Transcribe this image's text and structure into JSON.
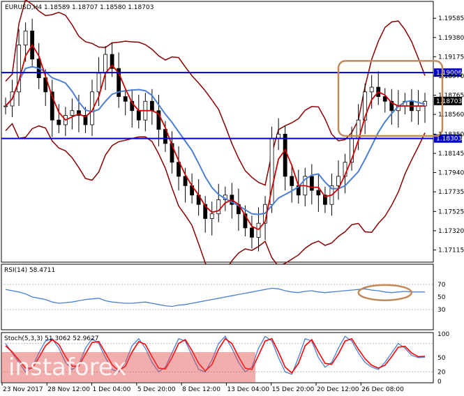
{
  "chart_data": [
    {
      "type": "candlestick",
      "panel": "price",
      "header": "EURUSD,H4  1.18589 1.18707 1.18580 1.18703",
      "ylim": [
        1.17,
        1.1975
      ],
      "y_ticks": [
        "1.19585",
        "1.19380",
        "1.19175",
        "1.18970",
        "1.18765",
        "1.18560",
        "1.18350",
        "1.18145",
        "1.17940",
        "1.17735",
        "1.17525",
        "1.17320",
        "1.17115"
      ],
      "y_tick_values": [
        1.19585,
        1.1938,
        1.19175,
        1.1897,
        1.18765,
        1.1856,
        1.1835,
        1.18145,
        1.1794,
        1.17735,
        1.17525,
        1.1732,
        1.17115
      ],
      "x_ticks": [
        "23 Nov 2017",
        "28 Nov 12:00",
        "1 Dec 04:00",
        "5 Dec 20:00",
        "8 Dec 12:00",
        "13 Dec 04:00",
        "15 Dec 20:00",
        "20 Dec 12:00",
        "26 Dec 08:00"
      ],
      "horizontal_levels": [
        {
          "value": 1.19006,
          "label": "1.19006",
          "color": "#0000cc"
        },
        {
          "value": 1.18303,
          "label": "1.18303",
          "color": "#0000cc"
        }
      ],
      "current_price": {
        "value": 1.18703,
        "label": "1.18703"
      },
      "series": [
        {
          "name": "",
          "color": "#cc0000",
          "kind": "ma_fast"
        },
        {
          "name": "",
          "color": "#4a7fd4",
          "kind": "ma_slow"
        },
        {
          "name": "",
          "color": "#8b0000",
          "kind": "bollinger"
        }
      ],
      "close_path": [
        1.1865,
        1.188,
        1.193,
        1.1945,
        1.1915,
        1.1895,
        1.188,
        1.185,
        1.1845,
        1.1855,
        1.186,
        1.1855,
        1.1845,
        1.188,
        1.19,
        1.192,
        1.1905,
        1.1875,
        1.187,
        1.186,
        1.185,
        1.187,
        1.186,
        1.184,
        1.1825,
        1.1805,
        1.179,
        1.178,
        1.177,
        1.176,
        1.1745,
        1.175,
        1.1765,
        1.177,
        1.176,
        1.175,
        1.1735,
        1.1725,
        1.174,
        1.176,
        1.183,
        1.1835,
        1.179,
        1.178,
        1.177,
        1.179,
        1.1775,
        1.177,
        1.176,
        1.178,
        1.179,
        1.1805,
        1.183,
        1.185,
        1.188,
        1.1885,
        1.1875,
        1.187,
        1.186,
        1.1865,
        1.187,
        1.186,
        1.1865,
        1.187
      ],
      "annotations": [
        {
          "shape": "rounded-rect",
          "color": "#c08a5a",
          "desc": "highlight box"
        }
      ]
    },
    {
      "type": "line",
      "panel": "rsi",
      "header": "RSI(14) 58.4711",
      "ylim": [
        0,
        100
      ],
      "y_ticks": [
        "70",
        "50",
        "30"
      ],
      "y_tick_values": [
        70,
        50,
        30
      ],
      "series": [
        {
          "name": "RSI(14)",
          "color": "#4a7fd4",
          "values": [
            62,
            60,
            58,
            55,
            50,
            48,
            46,
            42,
            40,
            41,
            42,
            44,
            46,
            47,
            48,
            44,
            42,
            41,
            40,
            40,
            41,
            42,
            40,
            38,
            36,
            35,
            37,
            38,
            40,
            42,
            44,
            46,
            48,
            50,
            52,
            54,
            56,
            58,
            60,
            62,
            64,
            63,
            60,
            58,
            57,
            59,
            60,
            58,
            57,
            58,
            59,
            60,
            61,
            62,
            63,
            61,
            60,
            58,
            57,
            58,
            59,
            58,
            58,
            58
          ]
        }
      ]
    },
    {
      "type": "line",
      "panel": "stochastic",
      "header": "Stoch(5,3,3) 51.3062 52.9627",
      "ylim": [
        0,
        100
      ],
      "y_ticks": [
        "100",
        "50",
        "20",
        "0"
      ],
      "y_tick_values": [
        100,
        50,
        20,
        0
      ],
      "series": [
        {
          "name": "",
          "color": "#4a7fd4",
          "values": [
            80,
            60,
            40,
            20,
            30,
            60,
            85,
            90,
            70,
            40,
            25,
            35,
            70,
            90,
            80,
            50,
            25,
            20,
            40,
            75,
            90,
            70,
            40,
            20,
            30,
            60,
            90,
            85,
            55,
            25,
            20,
            45,
            80,
            95,
            70,
            40,
            20,
            30,
            70,
            95,
            85,
            50,
            20,
            15,
            50,
            90,
            85,
            50,
            30,
            40,
            70,
            95,
            85,
            60,
            40,
            30,
            25,
            40,
            60,
            80,
            70,
            55,
            50,
            51
          ]
        },
        {
          "name": "",
          "color": "#ff0000",
          "values": [
            75,
            62,
            45,
            28,
            28,
            50,
            75,
            88,
            78,
            52,
            32,
            32,
            58,
            82,
            84,
            60,
            35,
            22,
            32,
            62,
            84,
            78,
            52,
            28,
            26,
            50,
            80,
            88,
            65,
            38,
            22,
            35,
            68,
            90,
            80,
            52,
            28,
            25,
            55,
            85,
            90,
            62,
            30,
            18,
            38,
            75,
            88,
            62,
            38,
            36,
            58,
            85,
            90,
            68,
            48,
            34,
            28,
            34,
            52,
            72,
            74,
            60,
            52,
            53
          ]
        }
      ]
    }
  ],
  "watermark": {
    "text": "instaforex",
    "brackets": "[ ]",
    "color": "#e34a4a"
  }
}
